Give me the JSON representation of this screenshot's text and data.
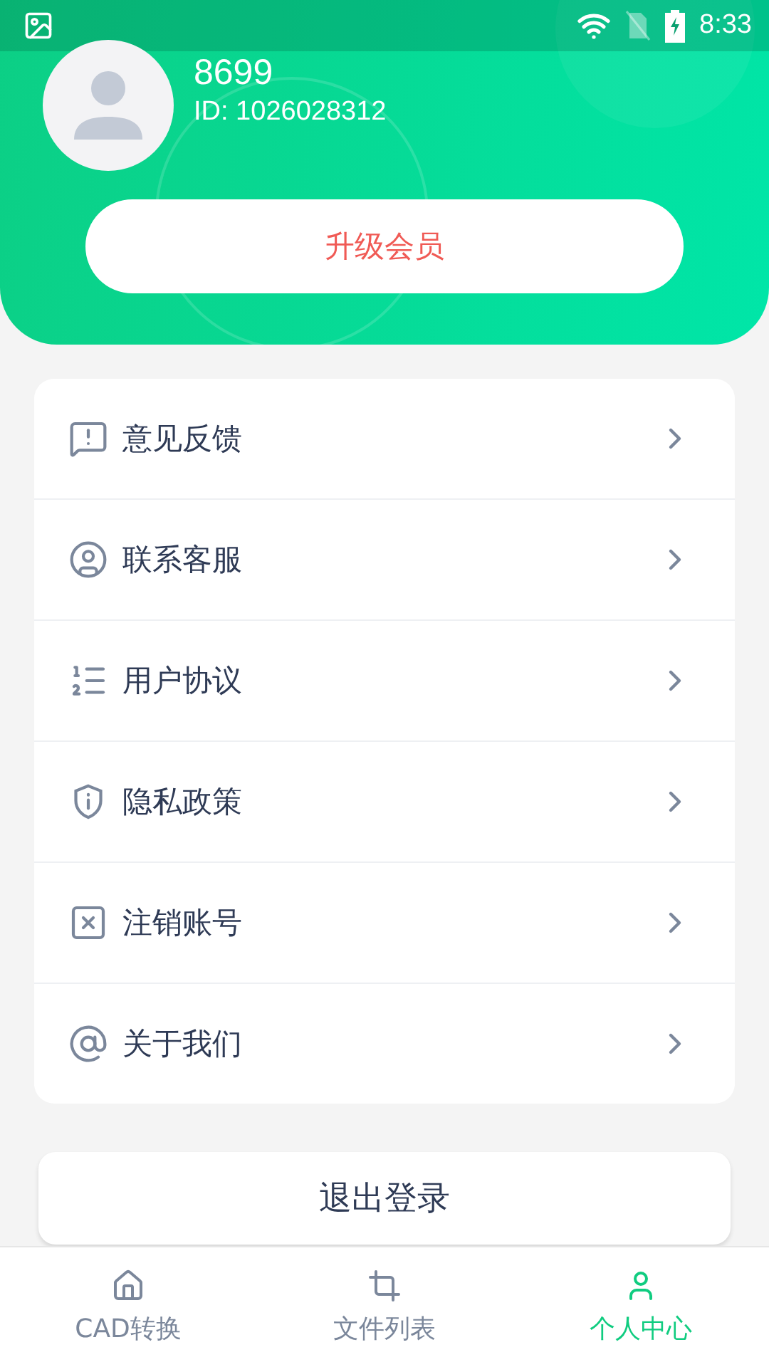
{
  "status_bar": {
    "time": "8:33"
  },
  "profile": {
    "name": "8699",
    "id": "ID: 1026028312",
    "upgrade_button": "升级会员"
  },
  "menu": [
    {
      "label": "意见反馈"
    },
    {
      "label": "联系客服"
    },
    {
      "label": "用户协议"
    },
    {
      "label": "隐私政策"
    },
    {
      "label": "注销账号"
    },
    {
      "label": "关于我们"
    }
  ],
  "logout_button": "退出登录",
  "tabs": [
    {
      "label": "CAD转换",
      "selected": false
    },
    {
      "label": "文件列表",
      "selected": false
    },
    {
      "label": "个人中心",
      "selected": true
    }
  ]
}
